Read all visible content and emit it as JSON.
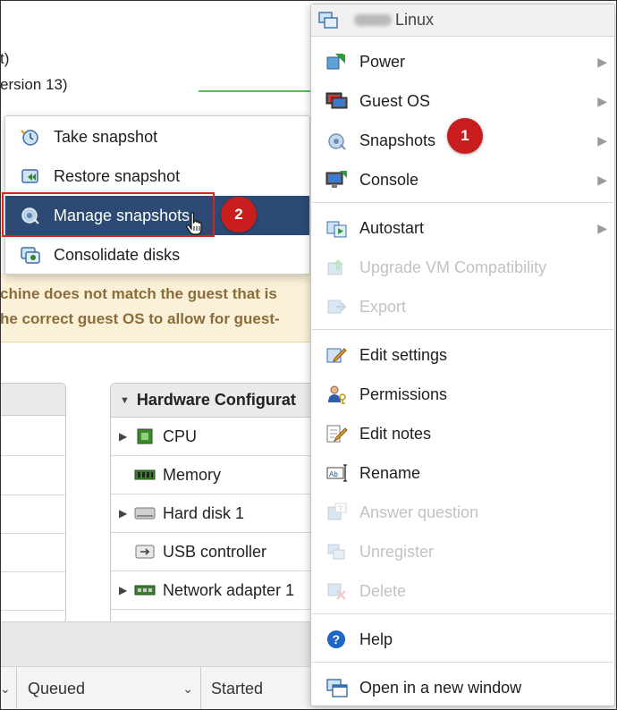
{
  "background": {
    "line1": "t)",
    "line2": "ersion 13)",
    "warning_line1": "chine does not match the guest that is",
    "warning_line2": "he correct guest OS to allow for guest-",
    "hardware_panel": {
      "title": "Hardware Configurat",
      "rows": [
        {
          "label": "CPU",
          "icon": "cpu-icon",
          "expandable": true
        },
        {
          "label": "Memory",
          "icon": "memory-icon",
          "expandable": false
        },
        {
          "label": "Hard disk 1",
          "icon": "hard-disk-icon",
          "expandable": true
        },
        {
          "label": "USB controller",
          "icon": "usb-icon",
          "expandable": false
        },
        {
          "label": "Network adapter 1",
          "icon": "network-adapter-icon",
          "expandable": true
        }
      ]
    },
    "tasks_columns": {
      "queued": "Queued",
      "started": "Started"
    }
  },
  "snapshots_submenu": {
    "items": [
      {
        "label": "Take snapshot",
        "icon": "take-snapshot-icon"
      },
      {
        "label": "Restore snapshot",
        "icon": "restore-snapshot-icon"
      },
      {
        "label": "Manage snapshots",
        "icon": "manage-snapshots-icon",
        "active": true
      },
      {
        "label": "Consolidate disks",
        "icon": "consolidate-disks-icon"
      }
    ]
  },
  "badges": {
    "step1": "1",
    "step2": "2"
  },
  "context_menu": {
    "title": "Linux",
    "items": [
      {
        "label": "Power",
        "icon": "power-icon",
        "submenu": true
      },
      {
        "label": "Guest OS",
        "icon": "guest-os-icon",
        "submenu": true
      },
      {
        "label": "Snapshots",
        "icon": "snapshots-icon",
        "submenu": true
      },
      {
        "label": "Console",
        "icon": "console-icon",
        "submenu": true
      },
      {
        "label": "Autostart",
        "icon": "autostart-icon",
        "submenu": true
      },
      {
        "label": "Upgrade VM Compatibility",
        "icon": "upgrade-icon",
        "disabled": true
      },
      {
        "label": "Export",
        "icon": "export-icon",
        "disabled": true
      },
      {
        "label": "Edit settings",
        "icon": "edit-settings-icon"
      },
      {
        "label": "Permissions",
        "icon": "permissions-icon"
      },
      {
        "label": "Edit notes",
        "icon": "edit-notes-icon"
      },
      {
        "label": "Rename",
        "icon": "rename-icon"
      },
      {
        "label": "Answer question",
        "icon": "answer-question-icon",
        "disabled": true
      },
      {
        "label": "Unregister",
        "icon": "unregister-icon",
        "disabled": true
      },
      {
        "label": "Delete",
        "icon": "delete-icon",
        "disabled": true
      },
      {
        "label": "Help",
        "icon": "help-icon"
      },
      {
        "label": "Open in a new window",
        "icon": "new-window-icon"
      }
    ]
  },
  "colors": {
    "active_item": "#2d4a74",
    "badge": "#c81e1e",
    "highlight_border": "#d9261c",
    "warning_bg": "#fbf1d8"
  }
}
